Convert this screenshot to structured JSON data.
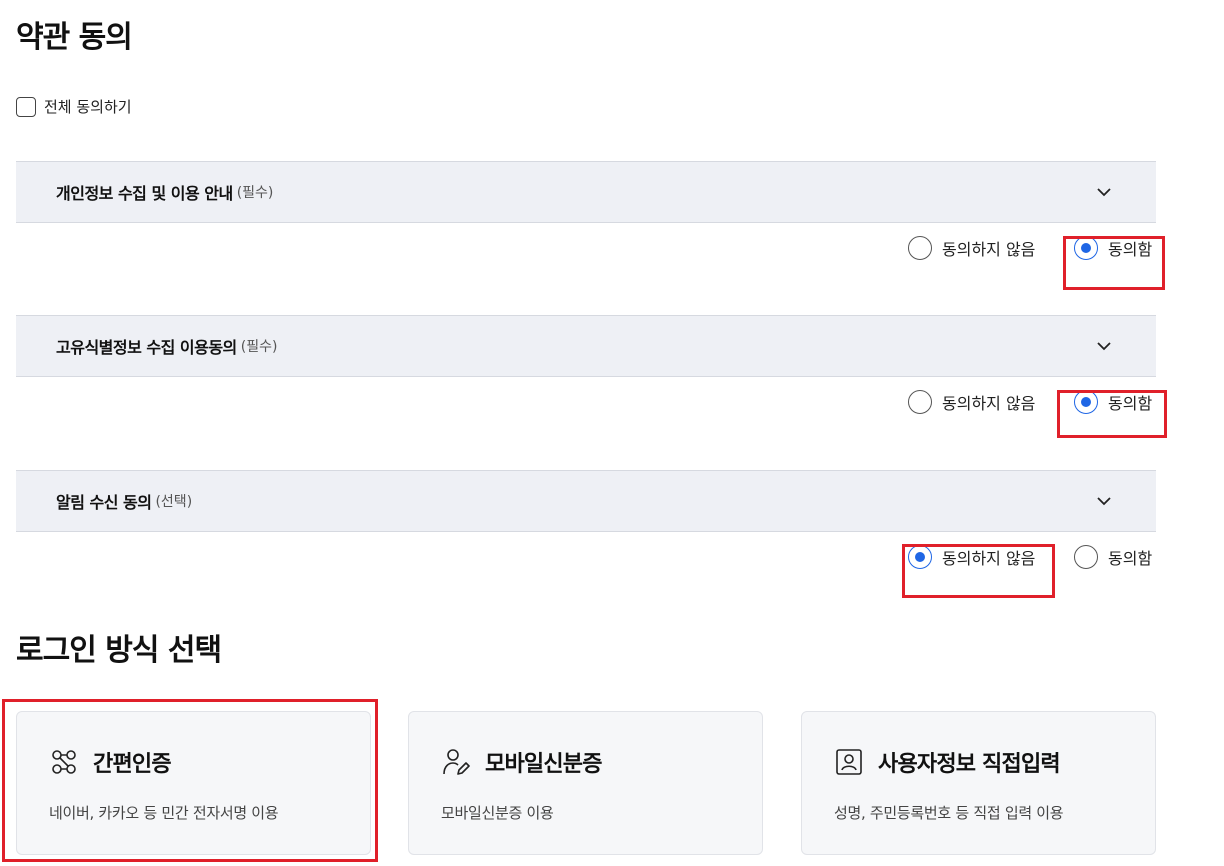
{
  "terms": {
    "title": "약관 동의",
    "all_agree_label": "전체 동의하기",
    "items": [
      {
        "title": "개인정보 수집 및 이용 안내",
        "tag": "(필수)",
        "disagree_label": "동의하지 않음",
        "agree_label": "동의함",
        "selected": "agree"
      },
      {
        "title": "고유식별정보 수집 이용동의",
        "tag": "(필수)",
        "disagree_label": "동의하지 않음",
        "agree_label": "동의함",
        "selected": "agree"
      },
      {
        "title": "알림 수신 동의",
        "tag": "(선택)",
        "disagree_label": "동의하지 않음",
        "agree_label": "동의함",
        "selected": "disagree"
      }
    ]
  },
  "login": {
    "title": "로그인 방식 선택",
    "cards": [
      {
        "title": "간편인증",
        "desc": "네이버, 카카오 등 민간 전자서명 이용",
        "icon": "simple-auth-icon"
      },
      {
        "title": "모바일신분증",
        "desc": "모바일신분증 이용",
        "icon": "mobile-id-icon"
      },
      {
        "title": "사용자정보 직접입력",
        "desc": "성명, 주민등록번호 등 직접 입력 이용",
        "icon": "user-info-icon"
      }
    ]
  },
  "colors": {
    "accent": "#1f66e5",
    "highlight": "#e0202a",
    "accordion_bg": "#eef0f5"
  }
}
